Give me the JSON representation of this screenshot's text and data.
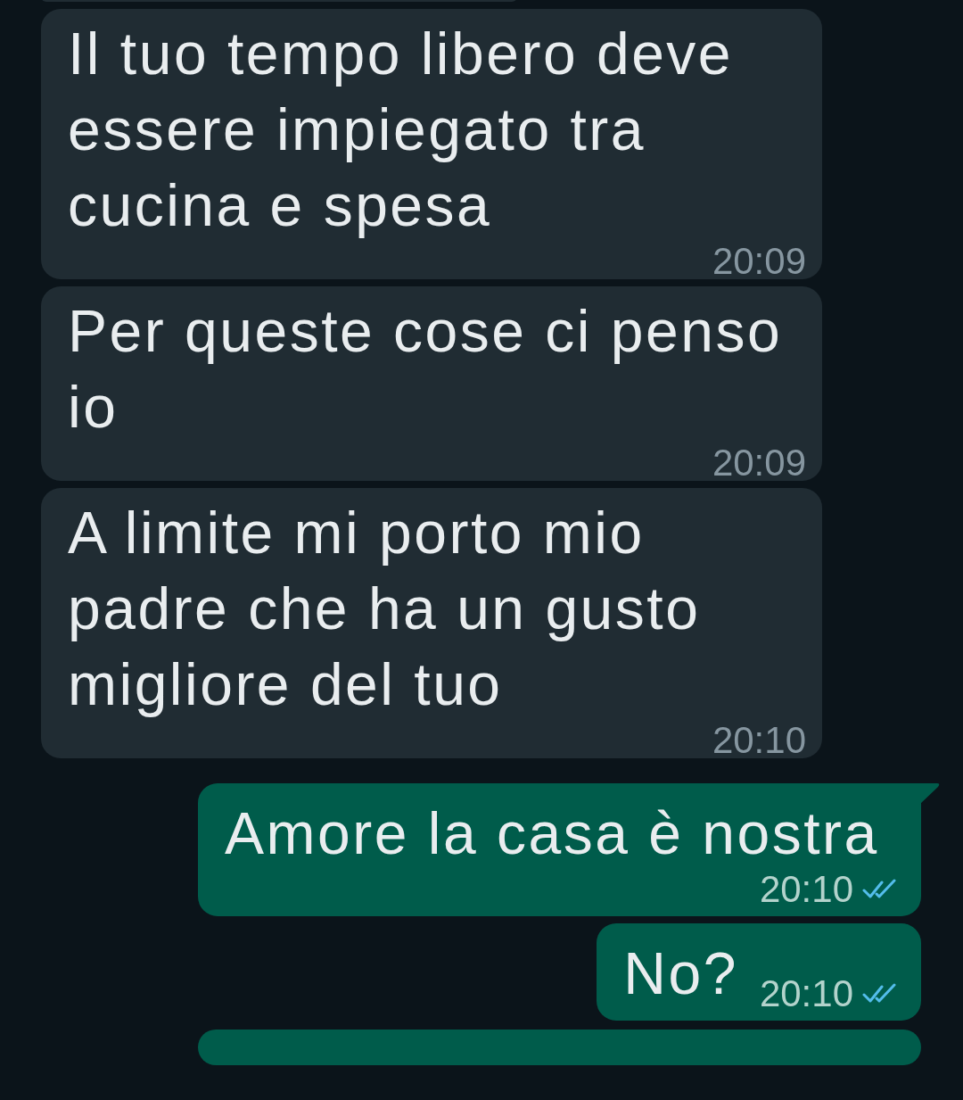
{
  "messages": [
    {
      "kind": "clipped",
      "outgoing": false
    },
    {
      "kind": "text",
      "outgoing": false,
      "text": "Il tuo tempo libero deve essere impiegato tra cucina e spesa",
      "time": "20:09",
      "tail": false
    },
    {
      "kind": "text",
      "outgoing": false,
      "text": "Per queste cose ci penso io",
      "time": "20:09",
      "tail": false
    },
    {
      "kind": "text",
      "outgoing": false,
      "text": "A limite mi porto mio padre che ha un gusto migliore del tuo",
      "time": "20:10",
      "tail": false
    },
    {
      "kind": "text",
      "outgoing": true,
      "text": "Amore la casa è nostra",
      "time": "20:10",
      "tail": true,
      "read": true
    },
    {
      "kind": "text",
      "outgoing": true,
      "text": "No?",
      "time": "20:10",
      "tail": false,
      "read": true
    },
    {
      "kind": "clipped",
      "outgoing": true
    }
  ]
}
